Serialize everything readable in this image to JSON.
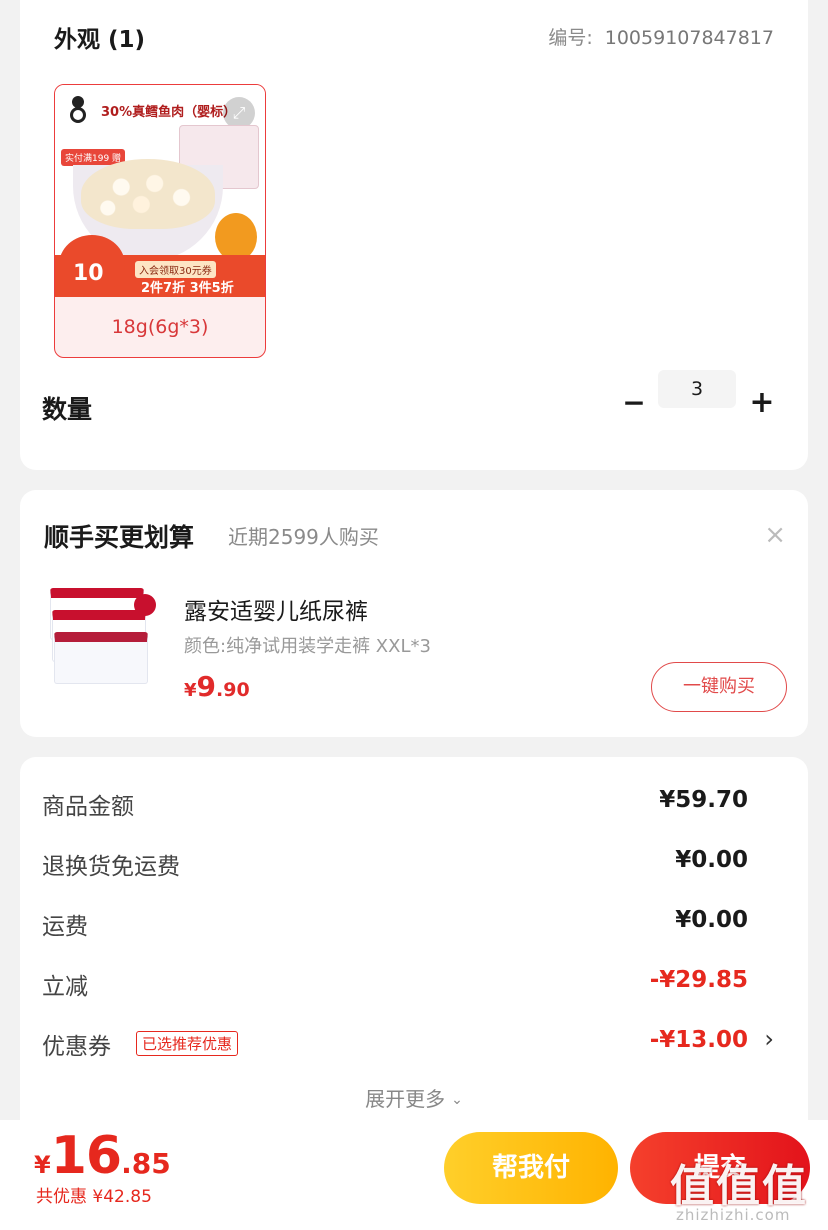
{
  "spec": {
    "title": "外观 (1)",
    "code_label": "编号:",
    "code_value": "10059107847817",
    "sku": {
      "label": "18g(6g*3)",
      "image": {
        "title": "30%真鳕鱼肉（婴标）",
        "promo_tag": "实付满199 赠",
        "promo_price": "10",
        "coupon": "入会领取30元券",
        "discount": "2件7折 3件5折"
      }
    },
    "quantity": {
      "label": "数量",
      "value": "3",
      "minus": "−",
      "plus": "+"
    }
  },
  "addon": {
    "title": "顺手买更划算",
    "subtitle": "近期2599人购买",
    "close": "×",
    "product": {
      "name": "露安适婴儿纸尿裤",
      "spec": "颜色:纯净试用装学走裤 XXL*3",
      "price_currency": "¥",
      "price_int": "9",
      "price_dec": ".90",
      "buy_label": "一键购买"
    }
  },
  "price_detail": {
    "rows": [
      {
        "label": "商品金额",
        "value": "¥59.70"
      },
      {
        "label": "退换货免运费",
        "value": "¥0.00"
      },
      {
        "label": "运费",
        "value": "¥0.00"
      },
      {
        "label": "立减",
        "value": "-¥29.85"
      },
      {
        "label": "优惠券",
        "tag": "已选推荐优惠",
        "value": "-¥13.00",
        "arrow": "›"
      }
    ],
    "expand_more": "展开更多",
    "expand_icon": "⌄"
  },
  "footer": {
    "total_currency": "¥",
    "total_int": "16",
    "total_dec": ".85",
    "saved": "共优惠 ¥42.85",
    "help_pay": "帮我付",
    "pay": "提交",
    "watermark": "值值值",
    "watermark_url": "zhizhizhi.com"
  },
  "colors": {
    "accent_red": "#e6281e",
    "help_yellow": "#ffbf1a",
    "background": "#f2f2f2"
  }
}
